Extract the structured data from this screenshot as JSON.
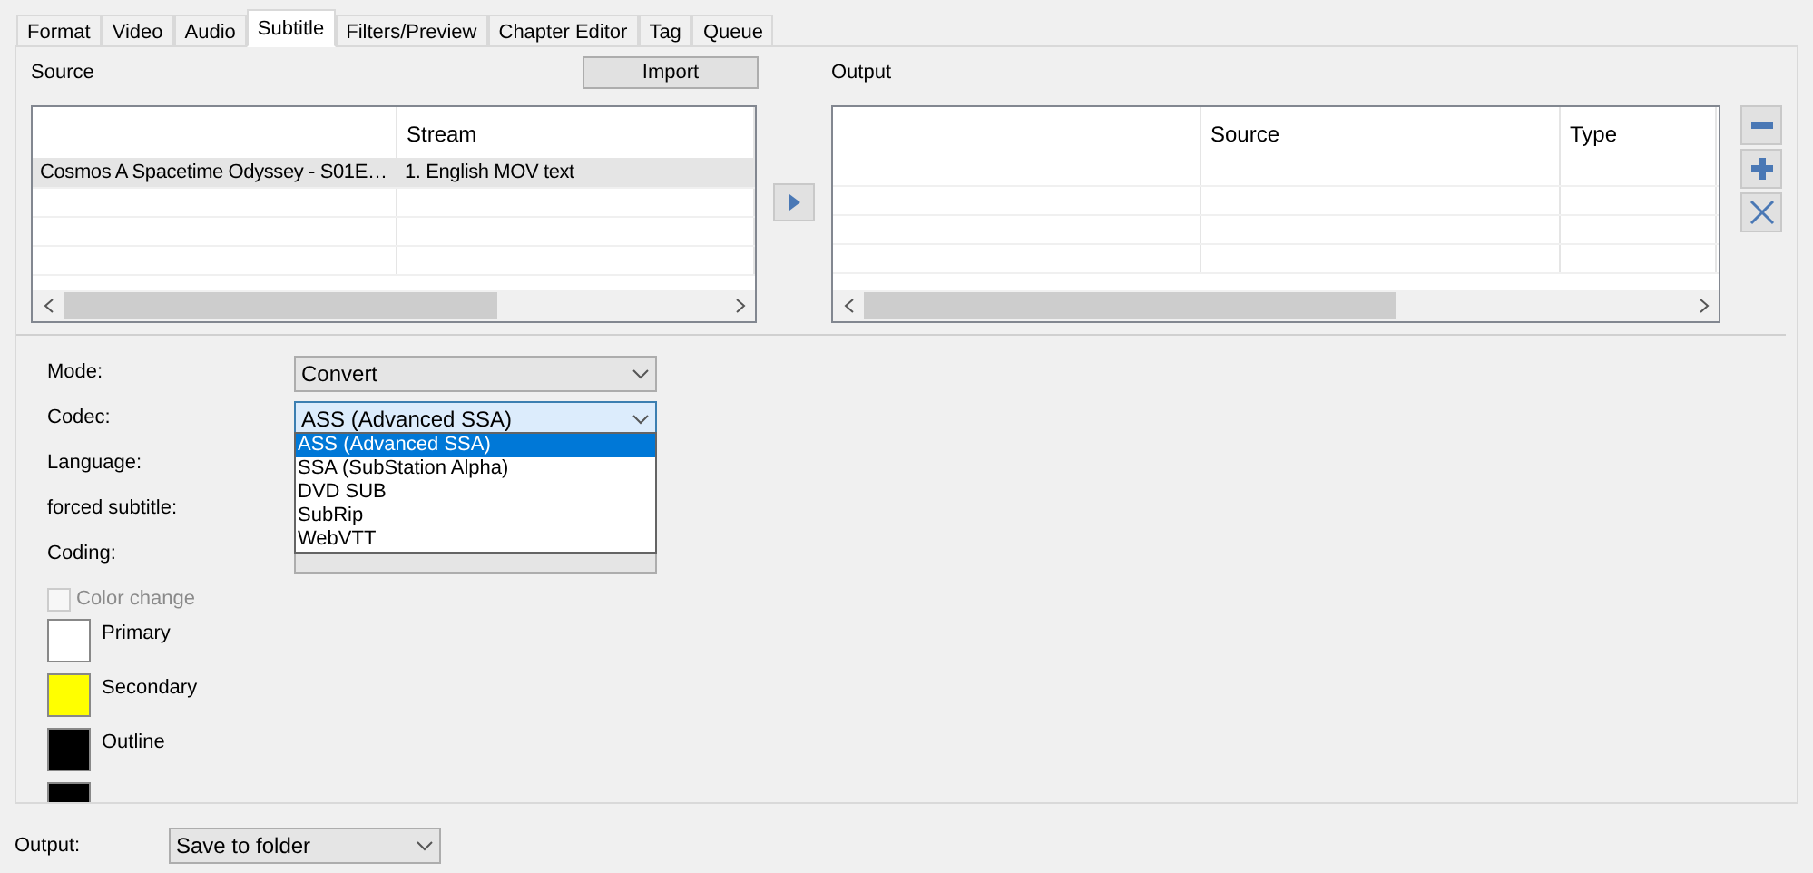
{
  "tabs": [
    {
      "label": "Format",
      "selected": false
    },
    {
      "label": "Video",
      "selected": false
    },
    {
      "label": "Audio",
      "selected": false
    },
    {
      "label": "Subtitle",
      "selected": true
    },
    {
      "label": "Filters/Preview",
      "selected": false
    },
    {
      "label": "Chapter Editor",
      "selected": false
    },
    {
      "label": "Tag",
      "selected": false
    },
    {
      "label": "Queue",
      "selected": false
    }
  ],
  "source": {
    "label": "Source",
    "import_button": "Import",
    "columns": [
      "",
      "Stream"
    ],
    "rows": [
      {
        "cells": [
          "Cosmos A Spacetime Odyssey - S01E…",
          "1. English MOV text"
        ],
        "selected": true
      }
    ]
  },
  "output_list": {
    "label": "Output",
    "columns": [
      "",
      "Source",
      "Type"
    ]
  },
  "form": {
    "mode": {
      "label": "Mode:",
      "value": "Convert"
    },
    "codec": {
      "label": "Codec:",
      "value": "ASS (Advanced SSA)",
      "expanded": true,
      "options": [
        {
          "label": "ASS (Advanced SSA)",
          "selected": true
        },
        {
          "label": "SSA (SubStation Alpha)",
          "selected": false
        },
        {
          "label": "DVD SUB",
          "selected": false
        },
        {
          "label": "SubRip",
          "selected": false
        },
        {
          "label": "WebVTT",
          "selected": false
        }
      ]
    },
    "language": {
      "label": "Language:"
    },
    "forced": {
      "label": "forced subtitle:"
    },
    "coding": {
      "label": "Coding:"
    },
    "color_change": {
      "label": "Color change",
      "checked": false,
      "disabled": true
    }
  },
  "colors": [
    {
      "label": "Primary",
      "color": "#ffffff"
    },
    {
      "label": "Secondary",
      "color": "#ffff00"
    },
    {
      "label": "Outline",
      "color": "#000000"
    },
    {
      "color": "#000000"
    }
  ],
  "output": {
    "label": "Output:",
    "value": "Save to folder"
  }
}
